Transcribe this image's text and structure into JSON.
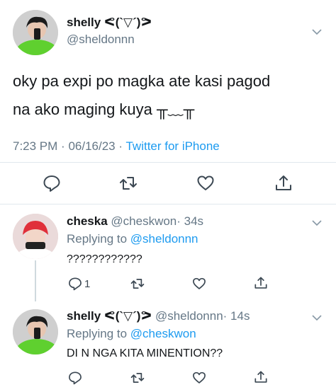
{
  "main_tweet": {
    "display_name": "shelly ᕙ(`▽´)ᕗ",
    "handle": "@sheldonnn",
    "text_line1": "oky pa expi po magka ate kasi pagod",
    "text_line2": "na ako maging kuya ╥﹏╥",
    "meta": {
      "time": "7:23 PM",
      "dot": "·",
      "date": "06/16/23",
      "source": "Twitter for iPhone"
    },
    "icons": [
      "reply-icon",
      "retweet-icon",
      "like-icon",
      "share-icon"
    ]
  },
  "replies": [
    {
      "display_name": "cheska",
      "handle": "@cheskwon",
      "time": "· 34s",
      "replying_prefix": "Replying to",
      "replying_to": "@sheldonnn",
      "text": "????????????",
      "reply_count": "1"
    },
    {
      "display_name": "shelly ᕙ(`▽´)ᕗ",
      "handle": "@sheldonnn",
      "time": "· 14s",
      "replying_prefix": "Replying to",
      "replying_to": "@cheskwon",
      "text": "DI N NGA KITA MINENTION??"
    }
  ],
  "colors": {
    "link": "#1d9bf0",
    "muted": "#657786",
    "divider": "#e1e8ed"
  }
}
